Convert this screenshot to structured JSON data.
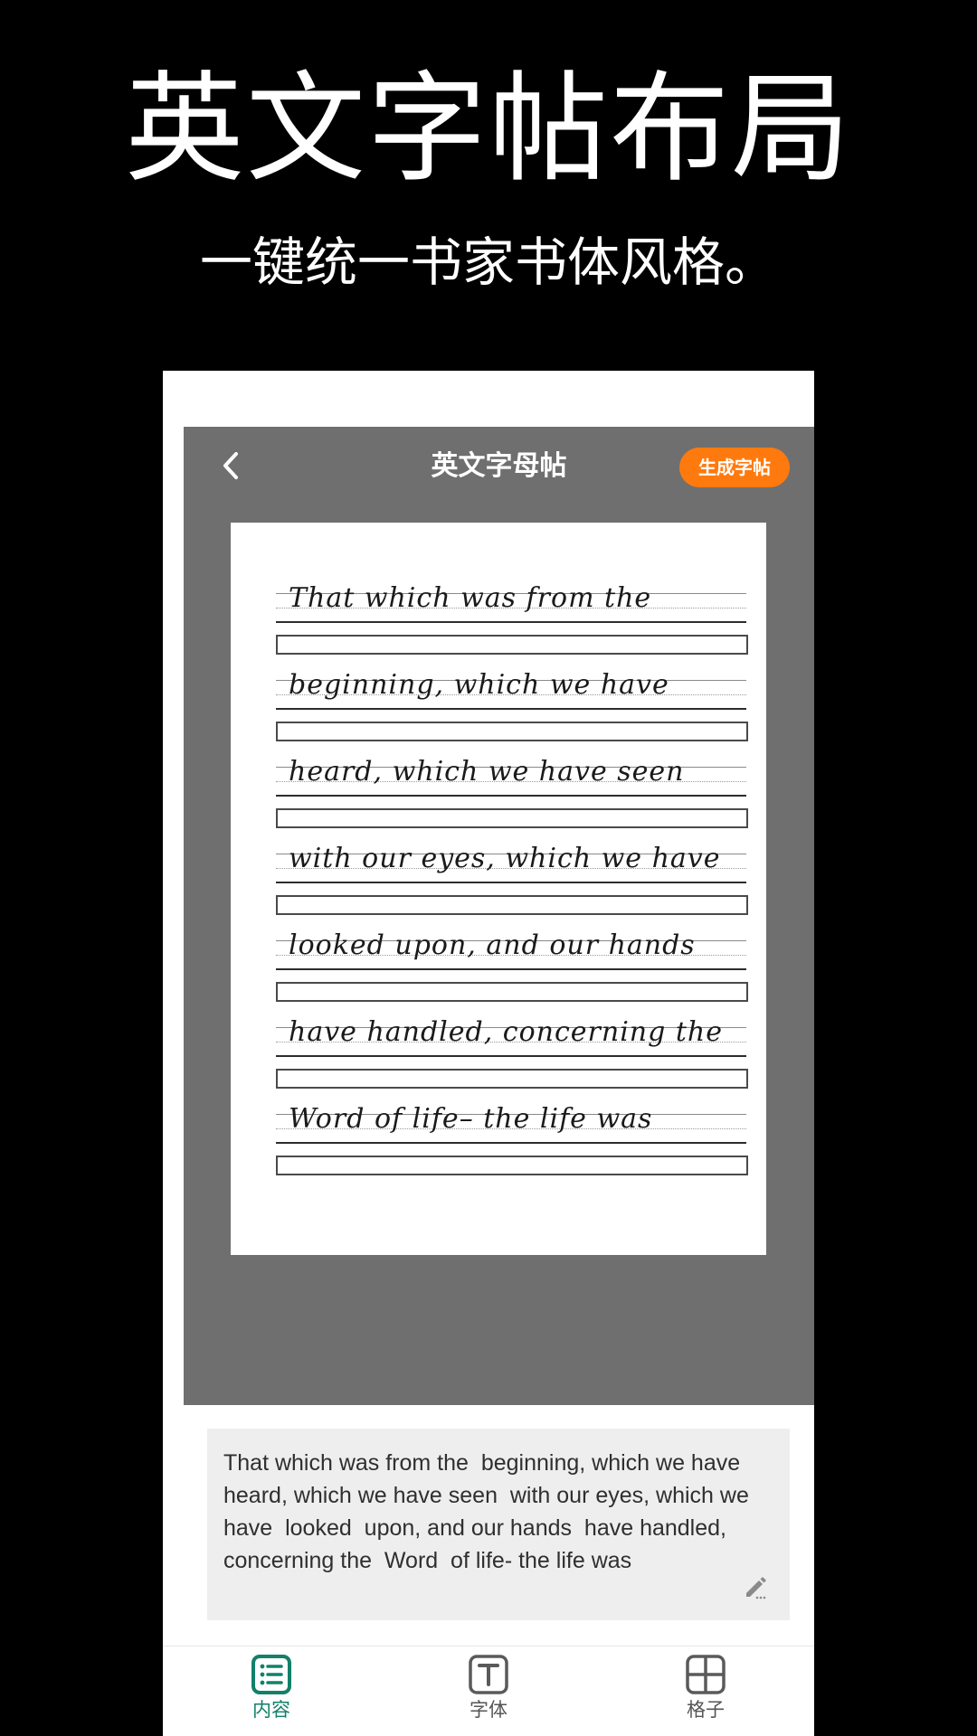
{
  "promo": {
    "title": "英文字帖布局",
    "subtitle": "一键统一书家书体风格。"
  },
  "header": {
    "title": "英文字母帖",
    "generate_label": "生成字帖",
    "back_icon": "chevron-left-icon"
  },
  "sheet": {
    "lines": [
      "That which was from the",
      "beginning, which we have",
      "heard, which we have seen",
      "with our eyes, which we have",
      "looked upon, and our hands",
      "have handled, concerning the",
      "Word of life–  the life was"
    ]
  },
  "content": {
    "text": "That which was from the  beginning, which we have heard, which we have seen  with our eyes, which we have  looked  upon, and our hands  have handled, concerning the  Word  of life- the life was",
    "edit_icon": "pencil-icon"
  },
  "tabs": [
    {
      "label": "内容",
      "icon": "list-icon",
      "active": true
    },
    {
      "label": "字体",
      "icon": "text-t-icon",
      "active": false
    },
    {
      "label": "格子",
      "icon": "grid-icon",
      "active": false
    }
  ],
  "colors": {
    "accent": "#ff7a0e",
    "active_tab": "#12806a",
    "editor_bg": "#6f6f6f"
  }
}
